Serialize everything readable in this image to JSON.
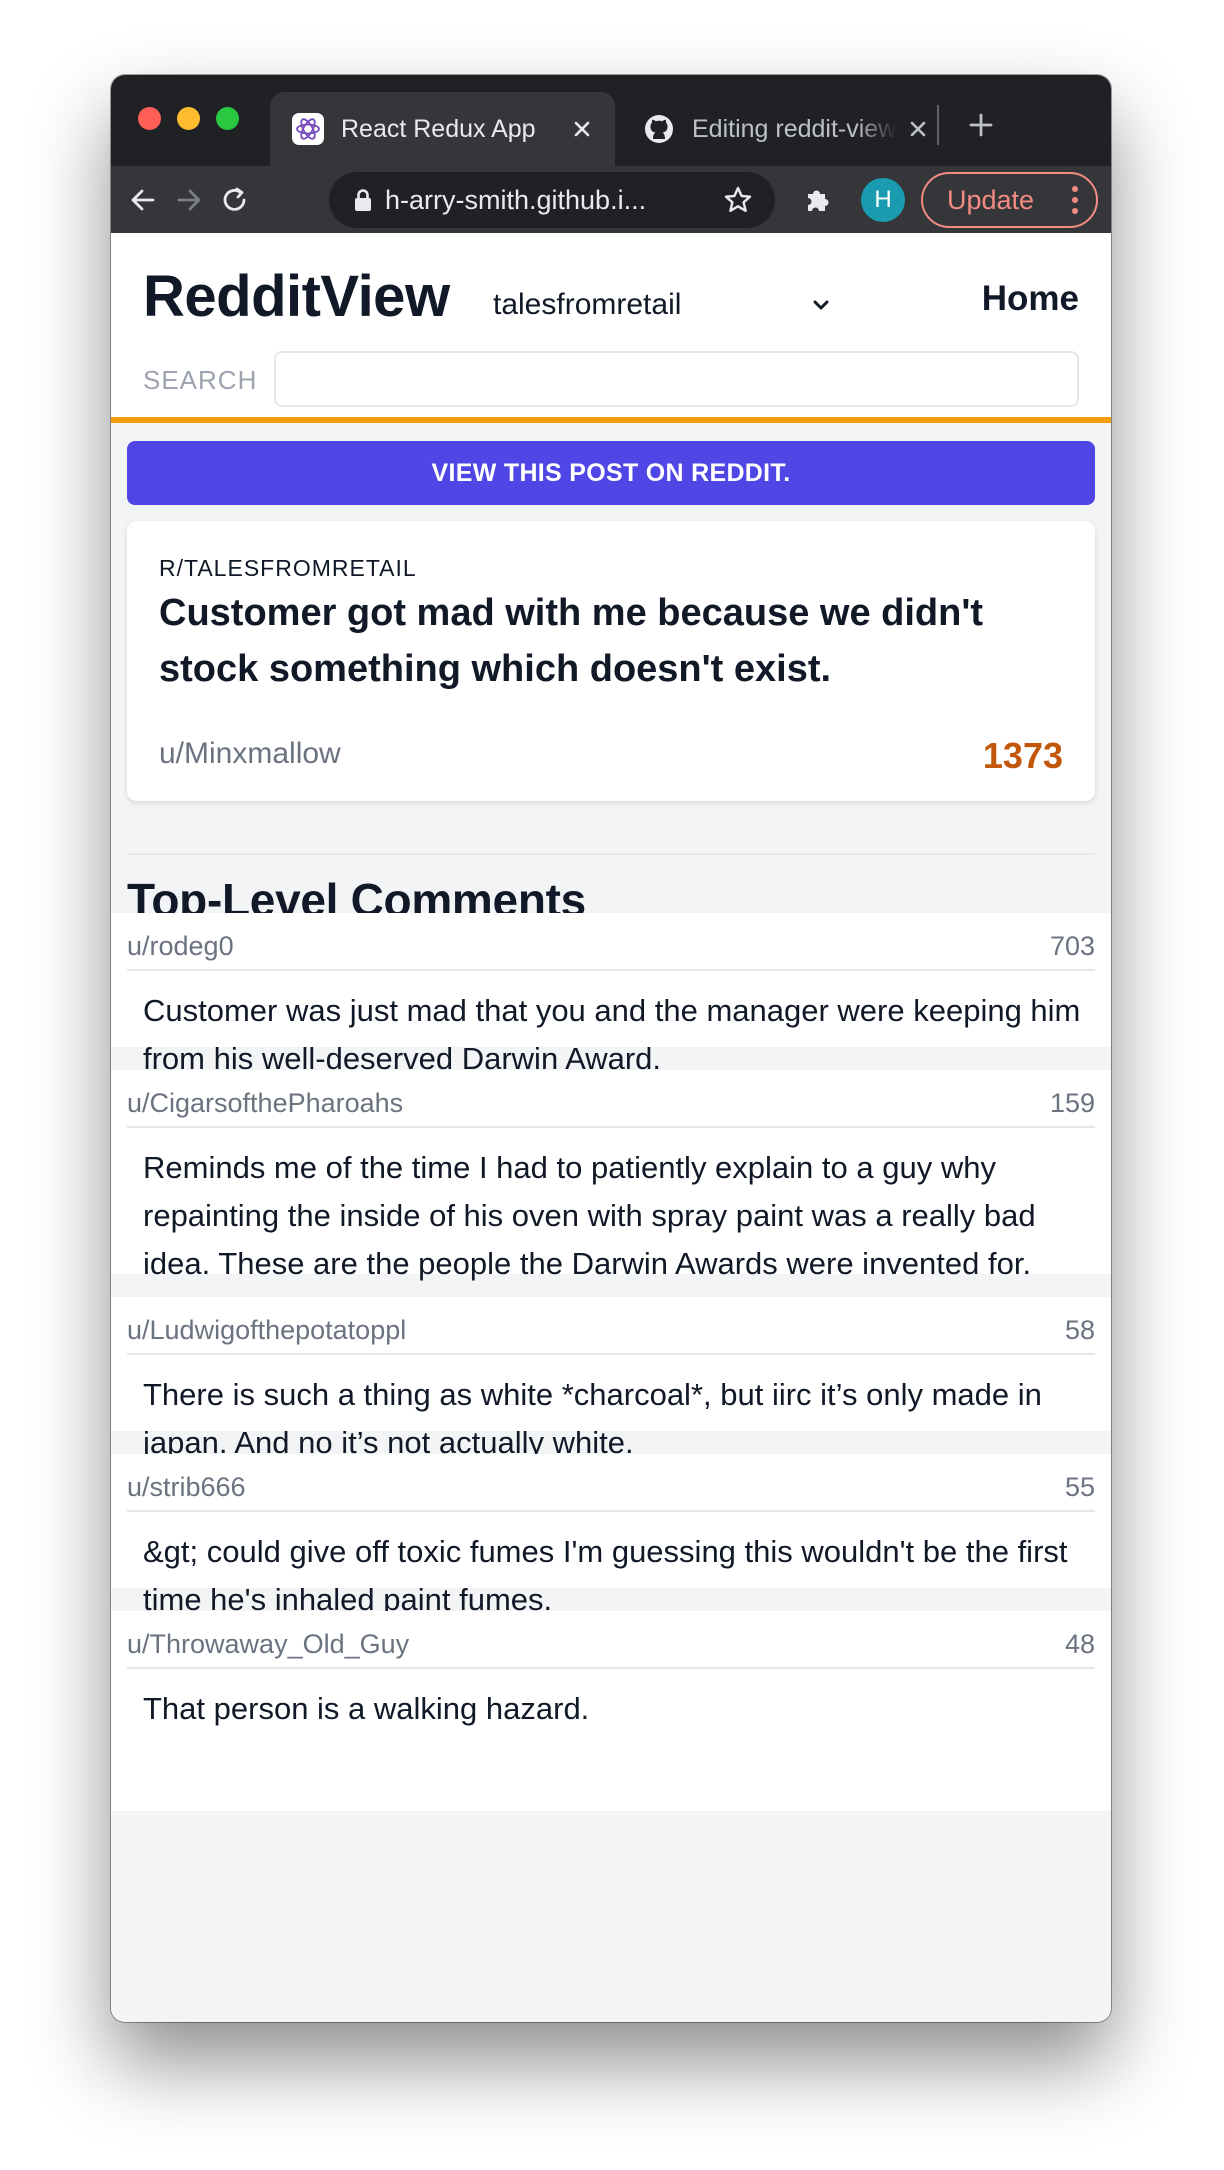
{
  "browser": {
    "tabs": [
      {
        "title": "React Redux App",
        "active": true,
        "favicon": "redux-icon"
      },
      {
        "title": "Editing reddit-view",
        "active": false,
        "favicon": "github-icon"
      }
    ],
    "url": "h-arry-smith.github.i...",
    "profile_initial": "H",
    "update_label": "Update"
  },
  "header": {
    "logo": "RedditView",
    "subreddit_selected": "talesfromretail",
    "home_label": "Home",
    "search_label": "SEARCH",
    "search_value": ""
  },
  "post": {
    "view_button_label": "VIEW THIS POST ON REDDIT.",
    "subreddit": "R/TALESFROMRETAIL",
    "title": "Customer got mad with me because we didn't stock something which doesn't exist.",
    "author": "u/Minxmallow",
    "score": "1373"
  },
  "comments_heading": "Top-Level Comments",
  "comments": [
    {
      "author": "u/rodeg0",
      "score": "703",
      "body": "Customer was just mad that you and the manager were keeping him from his well-deserved Darwin Award."
    },
    {
      "author": "u/CigarsofthePharoahs",
      "score": "159",
      "body": "Reminds me of the time I had to patiently explain to a guy why repainting the inside of his oven with spray paint was a really bad idea. These are the people the Darwin Awards were invented for."
    },
    {
      "author": "u/Ludwigofthepotatoppl",
      "score": "58",
      "body": "There is such a thing as white *charcoal*, but iirc it’s only made in japan. And no it’s not actually white."
    },
    {
      "author": "u/strib666",
      "score": "55",
      "body": "&gt; could give off toxic fumes I'm guessing this wouldn't be the first time he's inhaled paint fumes."
    },
    {
      "author": "u/Throwaway_Old_Guy",
      "score": "48",
      "body": "That person is a walking hazard."
    }
  ],
  "colors": {
    "accent_bar": "#f59e0b",
    "button": "#4f46e5",
    "score": "#c2570c",
    "update": "#f28b82"
  }
}
